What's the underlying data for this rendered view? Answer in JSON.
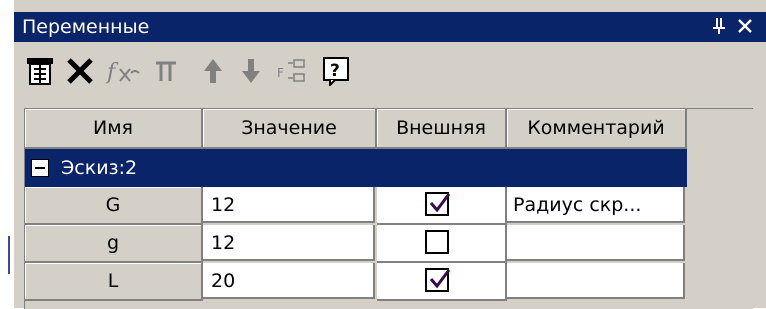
{
  "window": {
    "title": "Переменные",
    "pin_glyph": "ᵖ",
    "close_glyph": "×"
  },
  "toolbar": {
    "items": [
      {
        "icon": "variables-table-icon",
        "enabled": true
      },
      {
        "icon": "delete-x-icon",
        "enabled": true
      },
      {
        "icon": "function-fx-icon",
        "enabled": false
      },
      {
        "icon": "pi-constant-icon",
        "enabled": false
      },
      {
        "icon": "arrow-up-icon",
        "enabled": false
      },
      {
        "icon": "arrow-down-icon",
        "enabled": false
      },
      {
        "icon": "formula-reorder-icon",
        "enabled": false
      },
      {
        "icon": "help-icon",
        "enabled": true
      }
    ]
  },
  "table": {
    "columns": [
      "Имя",
      "Значение",
      "Внешняя",
      "Комментарий"
    ],
    "group": {
      "label": "Эскиз:2",
      "expanded": true
    },
    "rows": [
      {
        "name": "G",
        "value": "12",
        "external": true,
        "comment": "Радиус скр..."
      },
      {
        "name": "g",
        "value": "12",
        "external": false,
        "comment": ""
      },
      {
        "name": "L",
        "value": "20",
        "external": true,
        "comment": ""
      }
    ]
  },
  "colors": {
    "title_bg": "#0a246a",
    "panel_bg": "#d4d0c8",
    "check_mark": "#3a0a4a"
  }
}
